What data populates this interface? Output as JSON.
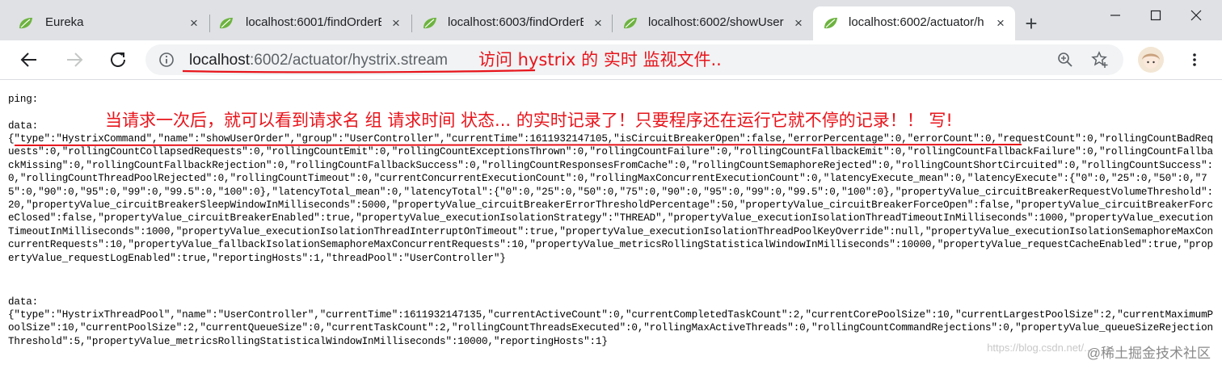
{
  "tabs": [
    {
      "title": "Eureka",
      "close": "×"
    },
    {
      "title": "localhost:6001/findOrderB",
      "close": "×"
    },
    {
      "title": "localhost:6003/findOrderB",
      "close": "×"
    },
    {
      "title": "localhost:6002/showUserO",
      "close": "×"
    },
    {
      "title": "localhost:6002/actuator/h",
      "close": "×"
    }
  ],
  "new_tab_label": "+",
  "window_controls": {
    "minimize": "—",
    "maximize": "☐",
    "close": "✕"
  },
  "address": {
    "host": "localhost",
    "rest": ":6002/actuator/hystrix.stream"
  },
  "annotations": {
    "url_note": "访问 hystrix 的 实时 监视文件..",
    "data_note": "当请求一次后，就可以看到请求名 组 请求时间 状态... 的实时记录了！只要程序还在运行它就不停的记录！！ 写!"
  },
  "stream": {
    "ping": "ping:",
    "data1_label": "data:",
    "data1": "{\"type\":\"HystrixCommand\",\"name\":\"showUserOrder\",\"group\":\"UserController\",\"currentTime\":1611932147105,\"isCircuitBreakerOpen\":false,\"errorPercentage\":0,\"errorCount\":0,\"requestCount\":0,\"rollingCountBadRequests\":0,\"rollingCountCollapsedRequests\":0,\"rollingCountEmit\":0,\"rollingCountExceptionsThrown\":0,\"rollingCountFailure\":0,\"rollingCountFallbackEmit\":0,\"rollingCountFallbackFailure\":0,\"rollingCountFallbackMissing\":0,\"rollingCountFallbackRejection\":0,\"rollingCountFallbackSuccess\":0,\"rollingCountResponsesFromCache\":0,\"rollingCountSemaphoreRejected\":0,\"rollingCountShortCircuited\":0,\"rollingCountSuccess\":0,\"rollingCountThreadPoolRejected\":0,\"rollingCountTimeout\":0,\"currentConcurrentExecutionCount\":0,\"rollingMaxConcurrentExecutionCount\":0,\"latencyExecute_mean\":0,\"latencyExecute\":{\"0\":0,\"25\":0,\"50\":0,\"75\":0,\"90\":0,\"95\":0,\"99\":0,\"99.5\":0,\"100\":0},\"latencyTotal_mean\":0,\"latencyTotal\":{\"0\":0,\"25\":0,\"50\":0,\"75\":0,\"90\":0,\"95\":0,\"99\":0,\"99.5\":0,\"100\":0},\"propertyValue_circuitBreakerRequestVolumeThreshold\":20,\"propertyValue_circuitBreakerSleepWindowInMilliseconds\":5000,\"propertyValue_circuitBreakerErrorThresholdPercentage\":50,\"propertyValue_circuitBreakerForceOpen\":false,\"propertyValue_circuitBreakerForceClosed\":false,\"propertyValue_circuitBreakerEnabled\":true,\"propertyValue_executionIsolationStrategy\":\"THREAD\",\"propertyValue_executionIsolationThreadTimeoutInMilliseconds\":1000,\"propertyValue_executionTimeoutInMilliseconds\":1000,\"propertyValue_executionIsolationThreadInterruptOnTimeout\":true,\"propertyValue_executionIsolationThreadPoolKeyOverride\":null,\"propertyValue_executionIsolationSemaphoreMaxConcurrentRequests\":10,\"propertyValue_fallbackIsolationSemaphoreMaxConcurrentRequests\":10,\"propertyValue_metricsRollingStatisticalWindowInMilliseconds\":10000,\"propertyValue_requestCacheEnabled\":true,\"propertyValue_requestLogEnabled\":true,\"reportingHosts\":1,\"threadPool\":\"UserController\"}",
    "data2_label": "data:",
    "data2": "{\"type\":\"HystrixThreadPool\",\"name\":\"UserController\",\"currentTime\":1611932147135,\"currentActiveCount\":0,\"currentCompletedTaskCount\":2,\"currentCorePoolSize\":10,\"currentLargestPoolSize\":2,\"currentMaximumPoolSize\":10,\"currentPoolSize\":2,\"currentQueueSize\":0,\"currentTaskCount\":2,\"rollingCountThreadsExecuted\":0,\"rollingMaxActiveThreads\":0,\"rollingCountCommandRejections\":0,\"propertyValue_queueSizeRejectionThreshold\":5,\"propertyValue_metricsRollingStatisticalWindowInMilliseconds\":10000,\"reportingHosts\":1}"
  },
  "watermark": {
    "faint": "https://blog.csdn.net/...",
    "logo_text": "@稀土掘金技术社区"
  },
  "colors": {
    "annotation": "#e8141b",
    "tab_strip": "#dfe1e5",
    "favicon": "#6db33f"
  }
}
